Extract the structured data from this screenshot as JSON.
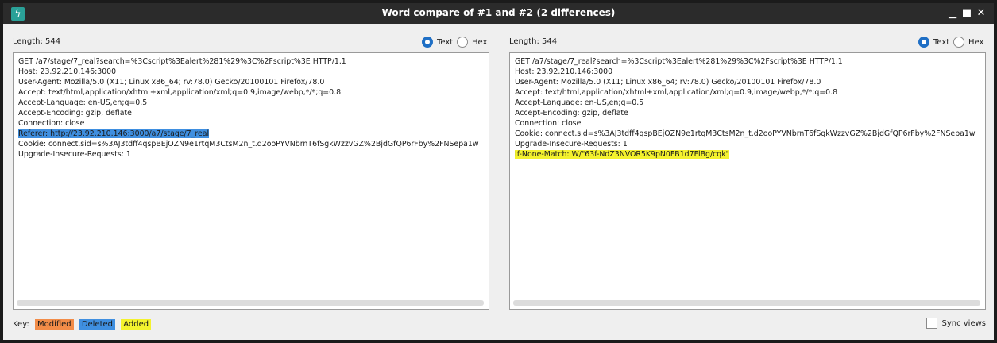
{
  "window": {
    "title": "Word compare of #1 and #2  (2 differences)",
    "app_icon_glyph": "ϟ",
    "controls": {
      "minimize": "▁",
      "maximize": "■",
      "close": "✕"
    }
  },
  "left": {
    "length_label": "Length: 544",
    "text_label": "Text",
    "hex_label": "Hex",
    "selected_view": "Text",
    "lines": [
      "GET /a7/stage/7_real?search=%3Cscript%3Ealert%281%29%3C%2Fscript%3E HTTP/1.1",
      "Host: 23.92.210.146:3000",
      "User-Agent: Mozilla/5.0 (X11; Linux x86_64; rv:78.0) Gecko/20100101 Firefox/78.0",
      "Accept: text/html,application/xhtml+xml,application/xml;q=0.9,image/webp,*/*;q=0.8",
      "Accept-Language: en-US,en;q=0.5",
      "Accept-Encoding: gzip, deflate",
      "Connection: close",
      "Referer: http://23.92.210.146:3000/a7/stage/7_real",
      "Cookie: connect.sid=s%3AJ3tdff4qspBEjOZN9e1rtqM3CtsM2n_t.d2ooPYVNbrnT6fSgkWzzvGZ%2BjdGfQP6rFby%2FNSepa1w",
      "Upgrade-Insecure-Requests: 1"
    ],
    "highlight_line": 7,
    "highlight_type": "deleted"
  },
  "right": {
    "length_label": "Length: 544",
    "text_label": "Text",
    "hex_label": "Hex",
    "selected_view": "Text",
    "lines": [
      "GET /a7/stage/7_real?search=%3Cscript%3Ealert%281%29%3C%2Fscript%3E HTTP/1.1",
      "Host: 23.92.210.146:3000",
      "User-Agent: Mozilla/5.0 (X11; Linux x86_64; rv:78.0) Gecko/20100101 Firefox/78.0",
      "Accept: text/html,application/xhtml+xml,application/xml;q=0.9,image/webp,*/*;q=0.8",
      "Accept-Language: en-US,en;q=0.5",
      "Accept-Encoding: gzip, deflate",
      "Connection: close",
      "Cookie: connect.sid=s%3AJ3tdff4qspBEjOZN9e1rtqM3CtsM2n_t.d2ooPYVNbrnT6fSgkWzzvGZ%2BjdGfQP6rFby%2FNSepa1w",
      "Upgrade-Insecure-Requests: 1",
      "If-None-Match: W/\"63f-NdZ3NVOR5K9pN0FB1d7FlBg/cqk\""
    ],
    "highlight_line": 9,
    "highlight_type": "added"
  },
  "footer": {
    "key_label": "Key:",
    "modified_label": "Modified",
    "deleted_label": "Deleted",
    "added_label": "Added",
    "sync_label": "Sync views"
  },
  "colors": {
    "modified": "#f28c48",
    "deleted": "#3f8fe0",
    "added": "#f4f22e",
    "accent": "#1f6fc5"
  }
}
